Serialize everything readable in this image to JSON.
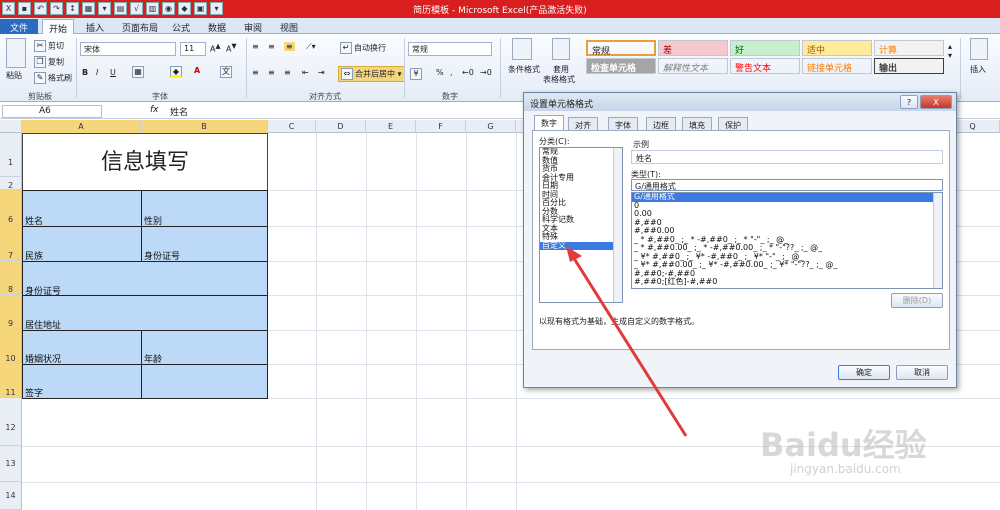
{
  "window": {
    "title": "简历模板 - Microsoft Excel(产品激活失败)"
  },
  "ribbon_tabs": [
    "文件",
    "开始",
    "插入",
    "页面布局",
    "公式",
    "数据",
    "审阅",
    "视图"
  ],
  "clipboard": {
    "paste": "粘贴",
    "cut": "剪切",
    "copy": "复制",
    "format_painter": "格式刷",
    "group": "剪贴板"
  },
  "font": {
    "name": "宋体",
    "size": "11",
    "bold": "B",
    "italic": "I",
    "underline": "U",
    "group": "字体",
    "special": "A"
  },
  "alignment": {
    "wrap": "自动换行",
    "merge": "合并后居中",
    "group": "对齐方式"
  },
  "number": {
    "format": "常规",
    "group": "数字",
    "percent": "%",
    "comma": ","
  },
  "styles": {
    "conditional": "条件格式",
    "table": "套用",
    "table2": "表格格式",
    "cells": [
      {
        "label": "常规",
        "bg": "#ffffff",
        "fg": "#000000"
      },
      {
        "label": "差",
        "bg": "#f7c7ce",
        "fg": "#9c0006"
      },
      {
        "label": "好",
        "bg": "#c6efce",
        "fg": "#006100"
      },
      {
        "label": "适中",
        "bg": "#ffeb9c",
        "fg": "#9c5700"
      },
      {
        "label": "计算",
        "bg": "#f2f2f2",
        "fg": "#fa7d00"
      },
      {
        "label": "检查单元格",
        "bg": "#a5a5a5",
        "fg": "#ffffff"
      },
      {
        "label": "解释性文本",
        "bg": "#ffffff",
        "fg": "#7f7f7f"
      },
      {
        "label": "警告文本",
        "bg": "#ffffff",
        "fg": "#ff0000"
      },
      {
        "label": "链接单元格",
        "bg": "#ffffff",
        "fg": "#fa7d00"
      },
      {
        "label": "输出",
        "bg": "#f2f2f2",
        "fg": "#3f3f3f"
      }
    ]
  },
  "insert_btn": "插入",
  "formula_bar": {
    "cell_ref": "A6",
    "fx": "fx",
    "value": "姓名"
  },
  "columns": [
    "A",
    "B",
    "C",
    "D",
    "E",
    "F",
    "G",
    "Q"
  ],
  "rows": [
    "1",
    "2",
    "6",
    "7",
    "8",
    "9",
    "10",
    "11",
    "12",
    "13",
    "14"
  ],
  "sheet": {
    "title": "信息填写",
    "name_label": "姓名",
    "gender_label": "性别",
    "ethnicity_label": "民族",
    "id_label_b": "身份证号",
    "id_label": "身份证号",
    "address_label": "居住地址",
    "marital_label": "婚姻状况",
    "age_label": "年龄",
    "signature_label": "签字"
  },
  "dialog": {
    "title": "设置单元格格式",
    "tabs": [
      "数字",
      "对齐",
      "字体",
      "边框",
      "填充",
      "保护"
    ],
    "category_label": "分类(C):",
    "categories": [
      "常规",
      "数值",
      "货币",
      "会计专用",
      "日期",
      "时间",
      "百分比",
      "分数",
      "科学记数",
      "文本",
      "特殊",
      "自定义"
    ],
    "selected_category": "自定义",
    "sample_label": "示例",
    "sample_value": "姓名",
    "type_label": "类型(T):",
    "type_value": "G/通用格式",
    "type_list": [
      "G/通用格式",
      "0",
      "0.00",
      "#,##0",
      "#,##0.00",
      "_ * #,##0_ ;_ * -#,##0_ ;_ * \"-\"_ ;_ @_",
      "_ * #,##0.00_ ;_ * -#,##0.00_ ;_ * \"-\"??_ ;_ @_",
      "_ ¥* #,##0_ ;_ ¥* -#,##0_ ;_ ¥* \"-\"_ ;_ @_",
      "_ ¥* #,##0.00_ ;_ ¥* -#,##0.00_ ;_ ¥* \"-\"??_ ;_ @_",
      "#,##0;-#,##0",
      "#,##0;[红色]-#,##0"
    ],
    "delete_button": "删除(D)",
    "description": "以现有格式为基础，生成自定义的数字格式。",
    "ok": "确定",
    "cancel": "取消",
    "help": "?",
    "close": "X"
  },
  "watermark": {
    "brand": "Baidu经验",
    "url": "jingyan.baidu.com"
  }
}
